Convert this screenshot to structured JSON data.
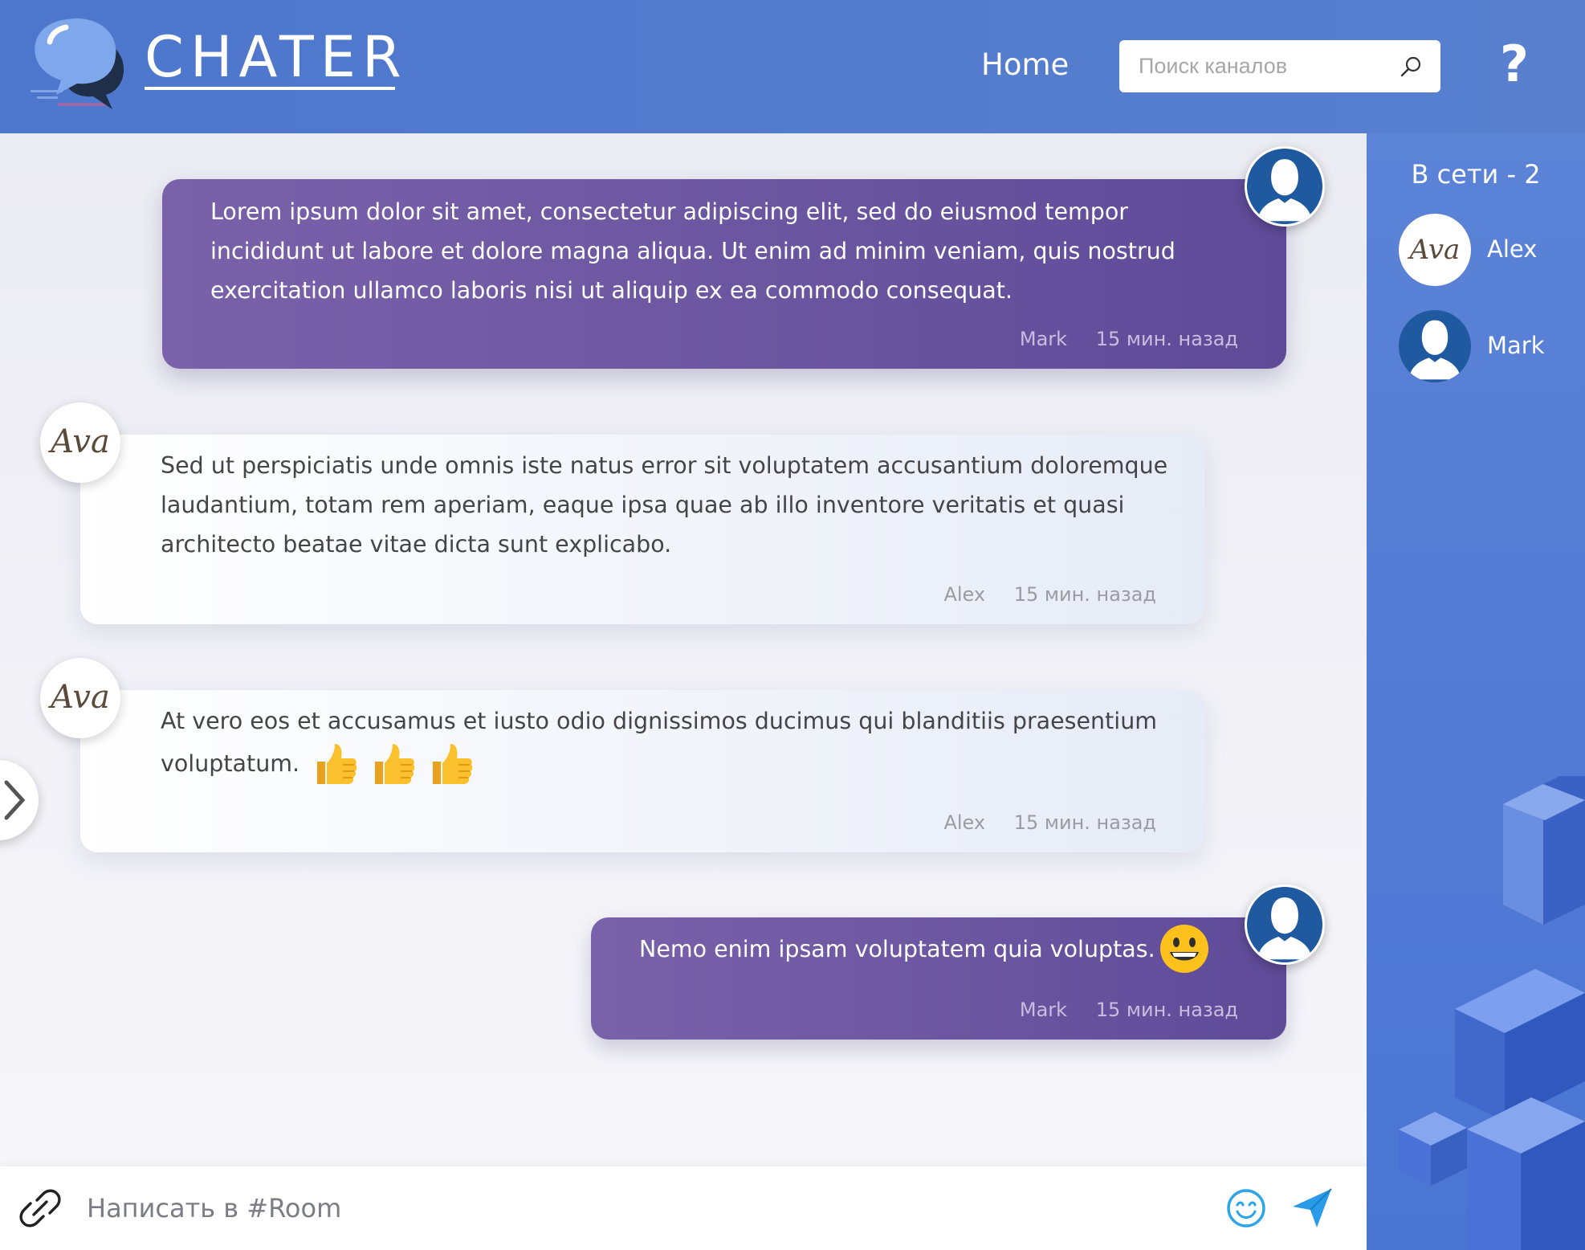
{
  "header": {
    "brand": "CHATER",
    "nav_home": "Home",
    "search_placeholder": "Поиск каналов",
    "help": "?"
  },
  "messages": [
    {
      "author": "Mark",
      "time": "15 мин. назад",
      "text": "Lorem ipsum dolor sit amet, consectetur adipiscing elit, sed do eiusmod tempor incididunt ut labore et dolore magna aliqua. Ut enim ad minim veniam, quis nostrud exercitation ullamco laboris nisi ut aliquip ex ea commodo consequat.",
      "avatar_icon": "user-silhouette-icon"
    },
    {
      "author": "Alex",
      "time": "15 мин. назад",
      "text": "Sed ut perspiciatis unde omnis iste natus error sit voluptatem accusantium doloremque laudantium, totam rem aperiam, eaque ipsa quae ab illo inventore veritatis et quasi architecto beatae vitae dicta sunt explicabo.",
      "avatar_icon": "ava-signature-avatar"
    },
    {
      "author": "Alex",
      "time": "15 мин. назад",
      "text_line1": "At vero eos et accusamus et iusto odio dignissimos ducimus qui blanditiis praesentium",
      "text_line2": "voluptatum.",
      "emojis": [
        "thumbs-up-icon",
        "thumbs-up-icon",
        "thumbs-up-icon"
      ],
      "avatar_icon": "ava-signature-avatar"
    },
    {
      "author": "Mark",
      "time": "15 мин. назад",
      "text": "Nemo enim ipsam voluptatem quia voluptas.",
      "emojis": [
        "grinning-face-icon"
      ],
      "avatar_icon": "user-silhouette-icon"
    }
  ],
  "composer": {
    "placeholder": "Написать в #Room"
  },
  "sidebar": {
    "online_title": "В сети - 2",
    "users": [
      {
        "name": "Alex",
        "avatar_icon": "ava-signature-avatar"
      },
      {
        "name": "Mark",
        "avatar_icon": "user-silhouette-icon"
      }
    ]
  },
  "colors": {
    "header_bg": "#4d77cd",
    "sidebar_bg": "#4a75d3",
    "mine_bubble": "#6a55a0",
    "other_bubble": "#f2f4fa",
    "avatar_blue": "#1f5aa0",
    "send_icon": "#2a9be8"
  },
  "avatar_signature": "Ava"
}
